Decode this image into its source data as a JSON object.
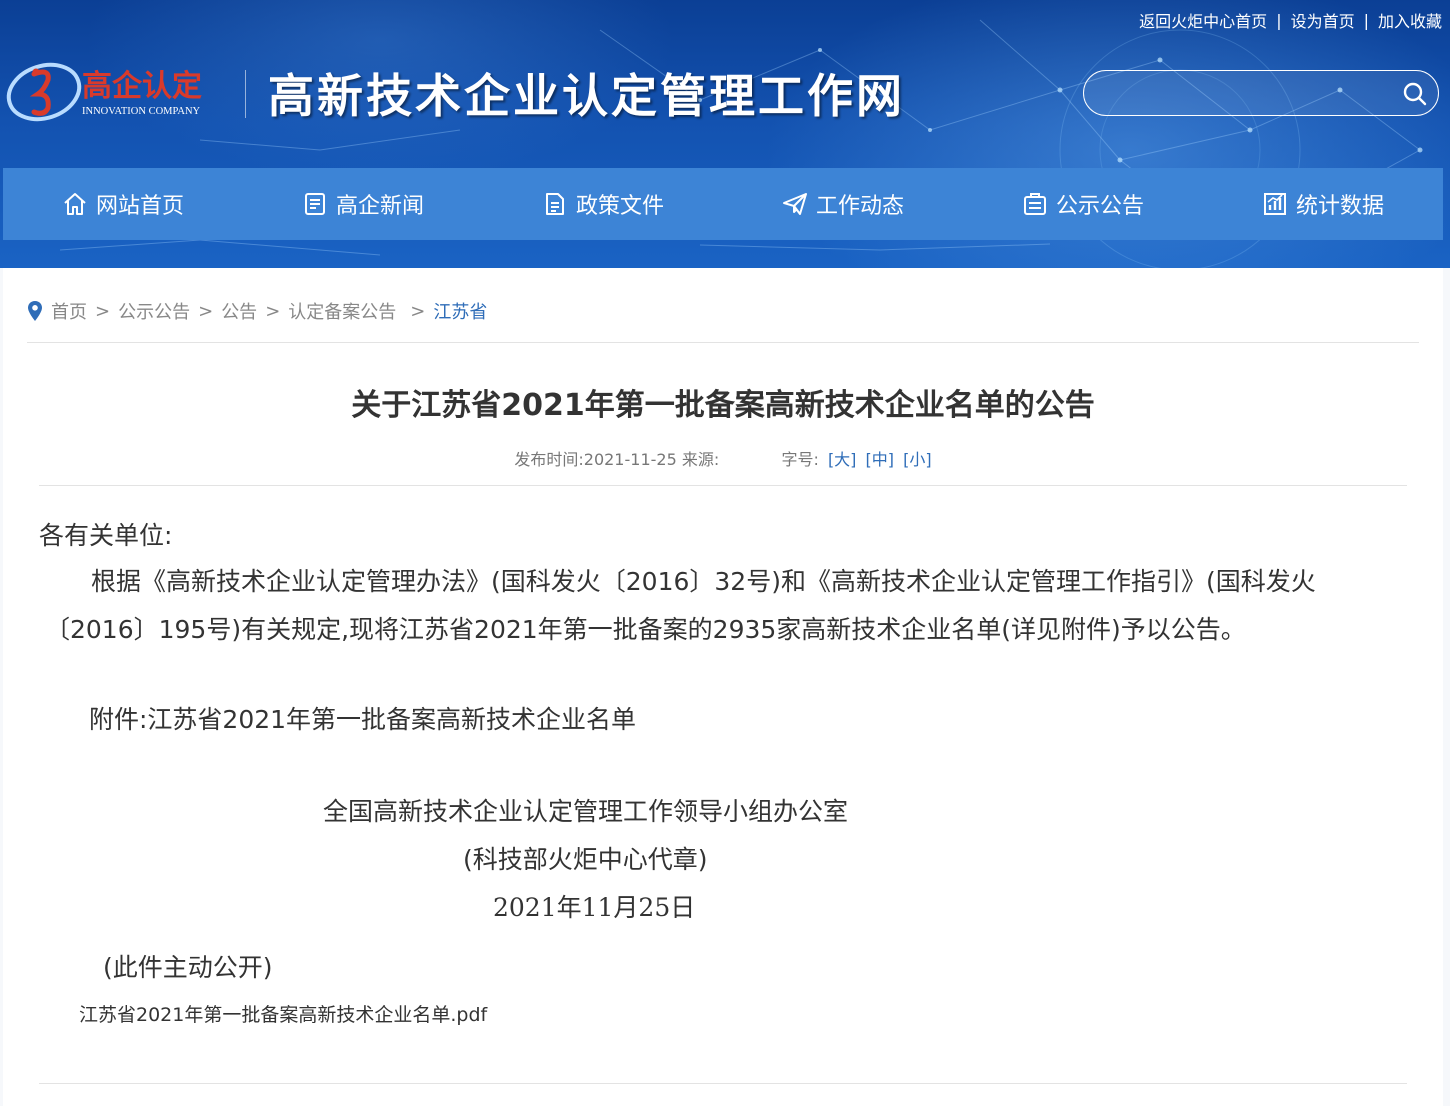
{
  "top_links": {
    "return_home": "返回火炬中心首页",
    "set_homepage": "设为首页",
    "add_favorite": "加入收藏",
    "separator": "|"
  },
  "logo": {
    "name": "高企认定",
    "english": "INNOVATION COMPANY",
    "accent_color": "#d93a2b"
  },
  "site_title": "高新技术企业认定管理工作网",
  "search": {
    "value": "",
    "placeholder": ""
  },
  "nav": {
    "items": [
      {
        "label": "网站首页",
        "icon": "home-icon"
      },
      {
        "label": "高企新闻",
        "icon": "news-icon"
      },
      {
        "label": "政策文件",
        "icon": "document-icon"
      },
      {
        "label": "工作动态",
        "icon": "paper-plane-icon"
      },
      {
        "label": "公示公告",
        "icon": "clipboard-icon"
      },
      {
        "label": "统计数据",
        "icon": "chart-icon"
      }
    ],
    "background": "#3d84d6"
  },
  "breadcrumb": {
    "items": [
      "首页",
      "公示公告",
      "公告",
      "认定备案公告",
      "江苏省"
    ],
    "separator": ">"
  },
  "article": {
    "title": "关于江苏省2021年第一批备案高新技术企业名单的公告",
    "meta": {
      "publish_label": "发布时间:",
      "publish_date": "2021-11-25",
      "source_label": "来源:",
      "font_size_label": "字号:",
      "font_large": "[大]",
      "font_medium": "[中]",
      "font_small": "[小]"
    },
    "greeting": "各有关单位:",
    "paragraph_line1": "根据《高新技术企业认定管理办法》(国科发火〔2016〕32号)和《高新技术企业认定管理工作指引》(国科发火",
    "paragraph_line2": "〔2016〕195号)有关规定,现将江苏省2021年第一批备案的2935家高新技术企业名单(详见附件)予以公告。",
    "attachment_line": "附件:江苏省2021年第一批备案高新技术企业名单",
    "signature_org": "全国高新技术企业认定管理工作领导小组办公室",
    "signature_seal": "(科技部火炬中心代章)",
    "signature_date": "2021年11月25日",
    "disclosure": "(此件主动公开)",
    "pdf_file": "江苏省2021年第一批备案高新技术企业名单.pdf"
  },
  "colors": {
    "link_blue": "#2f6db8",
    "banner_dark": "#0b3f95"
  }
}
